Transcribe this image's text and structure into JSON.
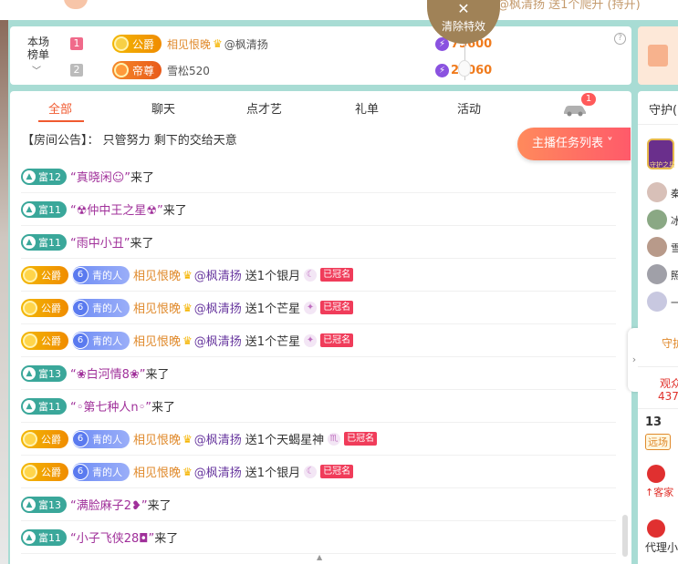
{
  "top": {
    "right_text": "@枫清扬 送1个爬升 (持开)"
  },
  "clear_effects": {
    "close_glyph": "✕",
    "label": "清除特效"
  },
  "rank": {
    "title_line1": "本场",
    "title_line2": "榜单",
    "rows": [
      {
        "rank": "1",
        "title": "公爵",
        "name": "相见恨晚",
        "at": "@枫清扬",
        "score": "75600"
      },
      {
        "rank": "2",
        "title": "帝尊",
        "name": "雪松520",
        "at": "",
        "score": "22060"
      }
    ]
  },
  "tabs": [
    "全部",
    "聊天",
    "点才艺",
    "礼单",
    "活动"
  ],
  "car_badge": "1",
  "announcement": {
    "label": "【房间公告】：",
    "text": "只管努力 剩下的交给天意"
  },
  "task_button": "主播任务列表",
  "messages": [
    {
      "type": "join",
      "wealth": "富12",
      "name": "“真晓闲☺”",
      "suffix": "来了"
    },
    {
      "type": "join",
      "wealth": "富11",
      "name": "“☢仲中王之星☢”",
      "suffix": "来了"
    },
    {
      "type": "join",
      "wealth": "富11",
      "name": "“雨中小丑”",
      "suffix": "来了"
    },
    {
      "type": "gift",
      "noble": "公爵",
      "fan_level": "6",
      "fan": "青的人",
      "user": "相见恨晚",
      "at": "@枫清扬",
      "action": "送1个银月",
      "crowned": "已冠名"
    },
    {
      "type": "gift",
      "noble": "公爵",
      "fan_level": "6",
      "fan": "青的人",
      "user": "相见恨晚",
      "at": "@枫清扬",
      "action": "送1个芒星",
      "crowned": "已冠名"
    },
    {
      "type": "gift",
      "noble": "公爵",
      "fan_level": "6",
      "fan": "青的人",
      "user": "相见恨晚",
      "at": "@枫清扬",
      "action": "送1个芒星",
      "crowned": "已冠名"
    },
    {
      "type": "join",
      "wealth": "富13",
      "name": "“❀白河情8❀”",
      "suffix": "来了"
    },
    {
      "type": "join",
      "wealth": "富11",
      "name": "“◦第七种人n◦”",
      "suffix": "来了"
    },
    {
      "type": "gift",
      "noble": "公爵",
      "fan_level": "6",
      "fan": "青的人",
      "user": "相见恨晚",
      "at": "@枫清扬",
      "action": "送1个天蝎星神",
      "crowned": "已冠名"
    },
    {
      "type": "gift",
      "noble": "公爵",
      "fan_level": "6",
      "fan": "青的人",
      "user": "相见恨晚",
      "at": "@枫清扬",
      "action": "送1个银月",
      "crowned": "已冠名"
    },
    {
      "type": "join",
      "wealth": "富13",
      "name": "“满脸麻子2❥”",
      "suffix": "来了"
    },
    {
      "type": "join",
      "wealth": "富11",
      "name": "“小子飞侠28◘”",
      "suffix": "来了"
    }
  ],
  "right": {
    "guard_title": "守护(",
    "guard_badge": "守护之星",
    "guard_names": [
      "秦",
      "冰",
      "雪",
      "照",
      "一"
    ],
    "guard_link": "守护",
    "audience_label": "观众",
    "audience_count": "437",
    "item_13": "13",
    "far": "远场",
    "guest": "↑客家",
    "agent": "代理小"
  },
  "colors": {
    "accent": "#f05a30",
    "background": "#a8dcd4",
    "wealth_badge": "#3aa79a",
    "clear_button": "#a08257"
  }
}
